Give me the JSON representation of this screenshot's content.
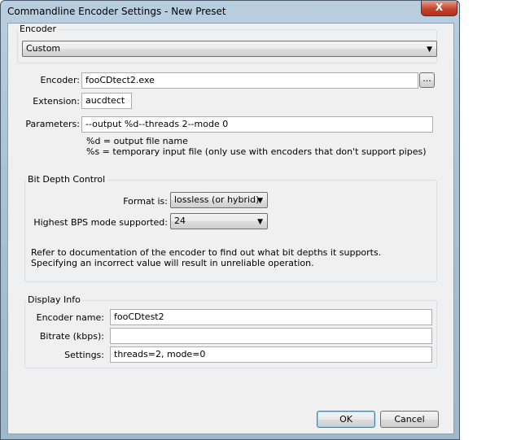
{
  "window": {
    "title": "Commandline Encoder Settings - New Preset",
    "close": "X"
  },
  "encoder_group": {
    "label": "Encoder",
    "preset": "Custom"
  },
  "fields": {
    "encoder_label": "Encoder:",
    "encoder_value": "fooCDtect2.exe",
    "browse": "...",
    "extension_label": "Extension:",
    "extension_value": "aucdtect",
    "parameters_label": "Parameters:",
    "parameters_value": "--output %d--threads 2--mode 0",
    "help1": "%d = output file name",
    "help2": "%s = temporary input file (only use with encoders that don't support pipes)"
  },
  "bit_depth": {
    "label": "Bit Depth Control",
    "format_label": "Format is:",
    "format_value": "lossless (or hybrid)",
    "bps_label": "Highest BPS mode supported:",
    "bps_value": "24",
    "note1": "Refer to documentation of the encoder to find out what bit depths it supports.",
    "note2": "Specifying an incorrect value will result in unreliable operation."
  },
  "display_info": {
    "label": "Display Info",
    "name_label": "Encoder name:",
    "name_value": "fooCDtest2",
    "bitrate_label": "Bitrate (kbps):",
    "bitrate_value": "",
    "settings_label": "Settings:",
    "settings_value": "threads=2, mode=0"
  },
  "buttons": {
    "ok": "OK",
    "cancel": "Cancel"
  }
}
